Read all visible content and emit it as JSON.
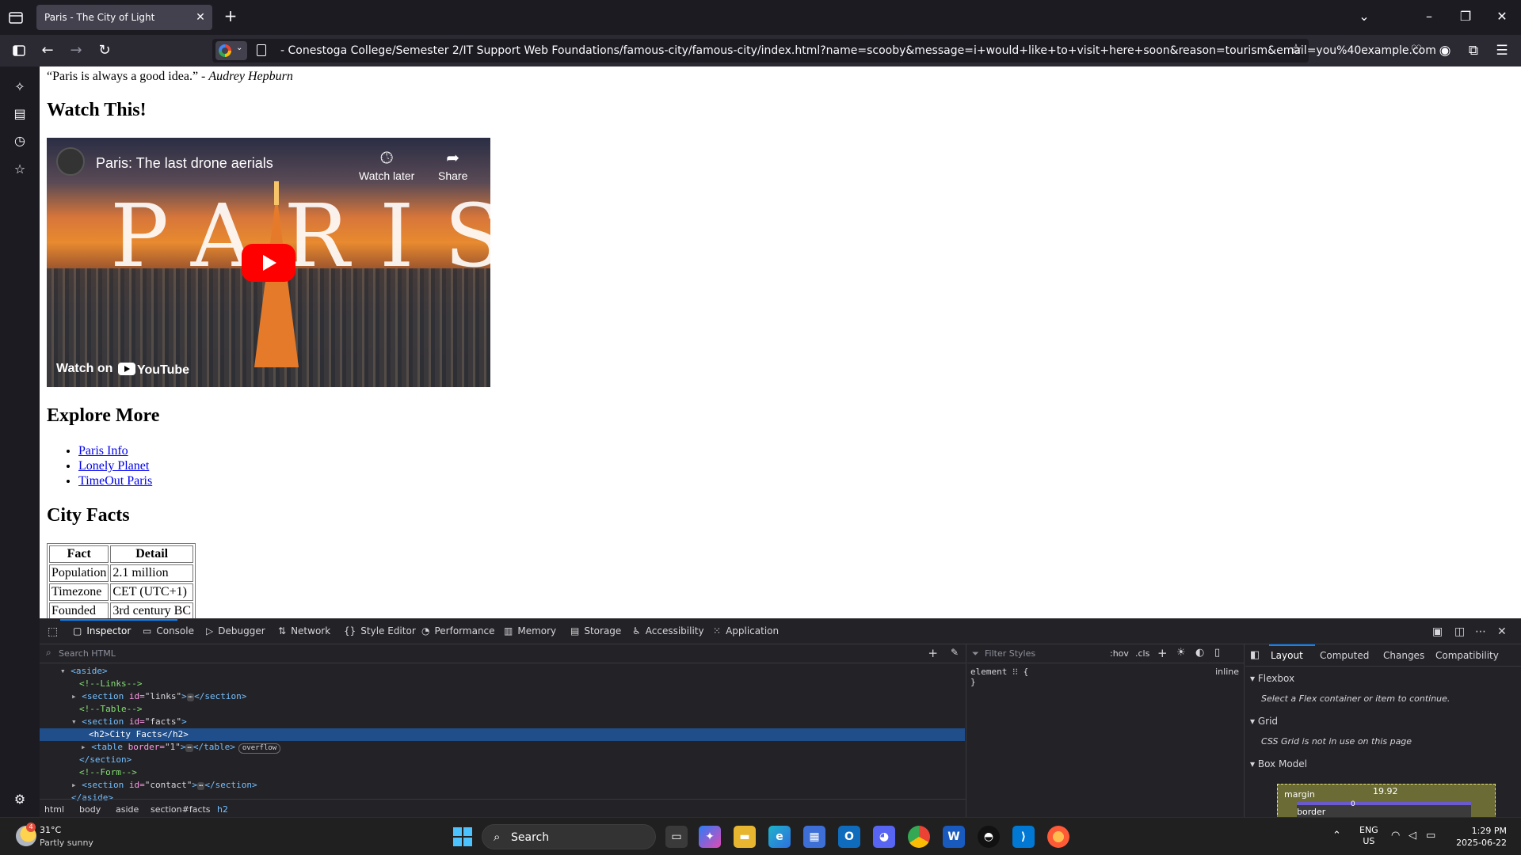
{
  "browser": {
    "tab_title": "Paris - The City of Light",
    "url": "- Conestoga College/Semester 2/IT Support Web Foundations/famous-city/famous-city/index.html?name=scooby&message=i+would+like+to+visit+here+soon&reason=tourism&email=you%40example.com"
  },
  "page": {
    "quote_text": "“Paris is always a good idea.” - ",
    "quote_author": "Audrey Hepburn",
    "watch_heading": "Watch This!",
    "video": {
      "title": "Paris: The last drone aerials",
      "overlay_text": "PARIS",
      "watch_later": "Watch later",
      "share": "Share",
      "watch_on": "Watch on",
      "youtube": "YouTube"
    },
    "explore_heading": "Explore More",
    "links": [
      "Paris Info",
      "Lonely Planet",
      "TimeOut Paris"
    ],
    "facts_heading": "City Facts",
    "facts_table": {
      "headers": [
        "Fact",
        "Detail"
      ],
      "rows": [
        [
          "Population",
          "2.1 million"
        ],
        [
          "Timezone",
          "CET (UTC+1)"
        ],
        [
          "Founded",
          "3rd century BC"
        ]
      ]
    }
  },
  "devtools": {
    "tabs": [
      "Inspector",
      "Console",
      "Debugger",
      "Network",
      "Style Editor",
      "Performance",
      "Memory",
      "Storage",
      "Accessibility",
      "Application"
    ],
    "search_placeholder": "Search HTML",
    "tree": {
      "aside_open": "<aside>",
      "links_comment": "<!--Links-->",
      "section_links_tag": "<section ",
      "section_links_attr": "id=",
      "section_links_val": "\"links\"",
      "section_close": "</section>",
      "table_comment": "<!--Table-->",
      "section_facts_val": "\"facts\"",
      "h2_line": "<h2>City Facts</h2>",
      "table_tag": "<table ",
      "table_attr": "border=",
      "table_val": "\"1\"",
      "table_close": "</table>",
      "overflow_badge": "overflow",
      "form_comment": "<!--Form-->",
      "section_contact_val": "\"contact\"",
      "aside_close": "</aside>",
      "ellipsis": "⋯"
    },
    "breadcrumbs": [
      "html",
      "body",
      "aside",
      "section#facts",
      "h2"
    ],
    "filter_styles": "Filter Styles",
    "hov": ":hov",
    "cls": ".cls",
    "rule_line1": "element ⁝⁝ {",
    "rule_line2": "}",
    "rule_inline": "inline",
    "layout_tabs": [
      "Layout",
      "Computed",
      "Changes",
      "Compatibility"
    ],
    "flexbox_heading": "Flexbox",
    "flexbox_msg": "Select a Flex container or item to continue.",
    "grid_heading": "Grid",
    "grid_msg": "CSS Grid is not in use on this page",
    "boxmodel_heading": "Box Model",
    "margin_label": "margin",
    "margin_value": "19.92",
    "border_label": "border",
    "border_value": "0"
  },
  "taskbar": {
    "weather_temp": "31°C",
    "weather_desc": "Partly sunny",
    "weather_badge": "4",
    "search_label": "Search",
    "lang_line1": "ENG",
    "lang_line2": "US",
    "time": "1:29 PM",
    "date": "2025-06-22"
  }
}
